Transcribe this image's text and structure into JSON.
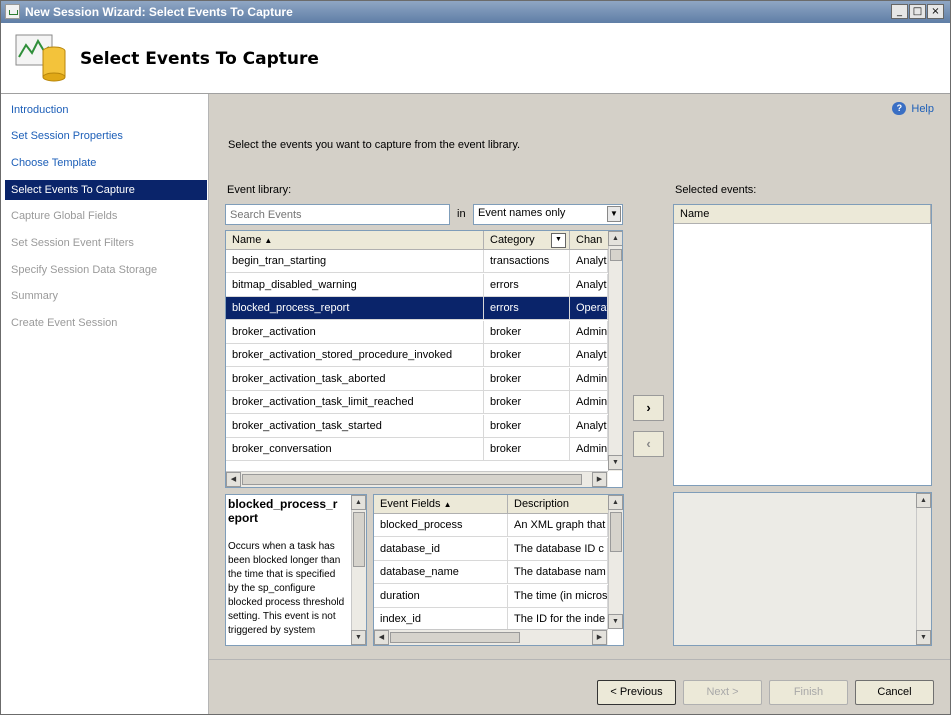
{
  "window": {
    "title": "New Session Wizard: Select Events To Capture"
  },
  "header": {
    "title": "Select Events To Capture"
  },
  "nav": {
    "items": [
      {
        "label": "Introduction",
        "state": "done"
      },
      {
        "label": "Set Session Properties",
        "state": "done"
      },
      {
        "label": "Choose Template",
        "state": "done"
      },
      {
        "label": "Select Events To Capture",
        "state": "current"
      },
      {
        "label": "Capture Global Fields",
        "state": "pending"
      },
      {
        "label": "Set Session Event Filters",
        "state": "pending"
      },
      {
        "label": "Specify Session Data Storage",
        "state": "pending"
      },
      {
        "label": "Summary",
        "state": "pending"
      },
      {
        "label": "Create Event Session",
        "state": "pending"
      }
    ]
  },
  "help_label": "Help",
  "instruction": "Select the events you want to capture from the event library.",
  "library": {
    "label": "Event library:",
    "search_placeholder": "Search Events",
    "in_label": "in",
    "filter_value": "Event names only",
    "columns": {
      "name": "Name",
      "category": "Category",
      "channel": "Chan"
    },
    "rows": [
      {
        "name": "begin_tran_starting",
        "category": "transactions",
        "channel": "Analyti"
      },
      {
        "name": "bitmap_disabled_warning",
        "category": "errors",
        "channel": "Analyti"
      },
      {
        "name": "blocked_process_report",
        "category": "errors",
        "channel": "Operat",
        "selected": true
      },
      {
        "name": "broker_activation",
        "category": "broker",
        "channel": "Admin"
      },
      {
        "name": "broker_activation_stored_procedure_invoked",
        "category": "broker",
        "channel": "Analyti"
      },
      {
        "name": "broker_activation_task_aborted",
        "category": "broker",
        "channel": "Admin"
      },
      {
        "name": "broker_activation_task_limit_reached",
        "category": "broker",
        "channel": "Admin"
      },
      {
        "name": "broker_activation_task_started",
        "category": "broker",
        "channel": "Analyti"
      },
      {
        "name": "broker_conversation",
        "category": "broker",
        "channel": "Admin"
      }
    ]
  },
  "description": {
    "title": "blocked_process_r eport",
    "body": "Occurs when a task has been blocked longer than the time that is specified by the sp_configure blocked process threshold setting. This event is not triggered by system"
  },
  "fields": {
    "columns": {
      "fields": "Event Fields",
      "description": "Description"
    },
    "rows": [
      {
        "field": "blocked_process",
        "description": "An XML graph that"
      },
      {
        "field": "database_id",
        "description": "The database ID c"
      },
      {
        "field": "database_name",
        "description": "The database nam"
      },
      {
        "field": "duration",
        "description": "The time (in micros"
      },
      {
        "field": "index_id",
        "description": "The ID for the inde"
      }
    ]
  },
  "selected": {
    "label": "Selected events:",
    "column": "Name"
  },
  "move": {
    "add": "›",
    "remove": "‹"
  },
  "footer": {
    "previous": "< Previous",
    "next": "Next >",
    "finish": "Finish",
    "cancel": "Cancel"
  },
  "icons": {
    "header": "event-wizard-icon",
    "sort": "sort-ascending-icon",
    "help": "help-icon"
  }
}
